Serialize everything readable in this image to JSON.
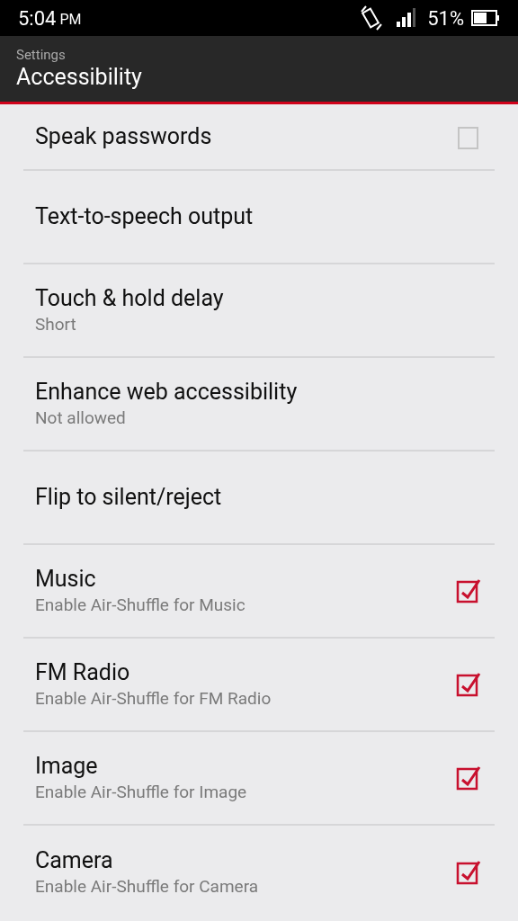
{
  "status_bar": {
    "time": "5:04",
    "ampm": "PM",
    "battery": "51%"
  },
  "header": {
    "breadcrumb": "Settings",
    "title": "Accessibility"
  },
  "items": [
    {
      "kind": "checkbox",
      "title": "Speak passwords",
      "checked": false
    },
    {
      "kind": "plain",
      "title": "Text-to-speech output"
    },
    {
      "kind": "plain",
      "title": "Touch & hold delay",
      "summary": "Short"
    },
    {
      "kind": "plain",
      "title": "Enhance web accessibility",
      "summary": "Not allowed"
    },
    {
      "kind": "plain",
      "title": "Flip to silent/reject"
    },
    {
      "kind": "checkbox",
      "title": "Music",
      "summary": "Enable Air-Shuffle for Music",
      "checked": true
    },
    {
      "kind": "checkbox",
      "title": "FM Radio",
      "summary": "Enable Air-Shuffle for FM Radio",
      "checked": true
    },
    {
      "kind": "checkbox",
      "title": "Image",
      "summary": "Enable Air-Shuffle for Image",
      "checked": true
    },
    {
      "kind": "checkbox",
      "title": "Camera",
      "summary": "Enable Air-Shuffle for Camera",
      "checked": true
    }
  ]
}
